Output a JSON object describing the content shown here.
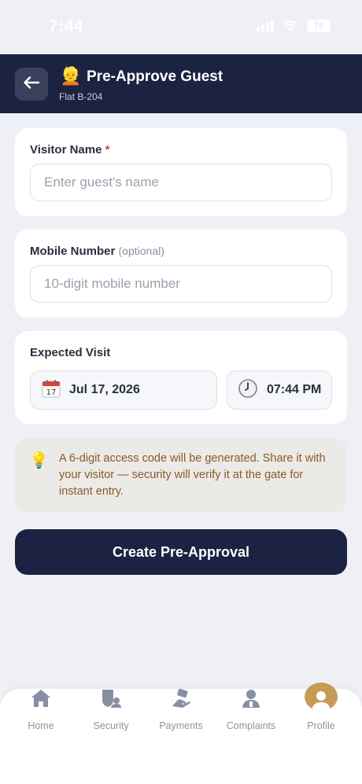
{
  "status_bar": {
    "time": "7:44",
    "battery": "78"
  },
  "header": {
    "emoji": "👱",
    "title": "Pre-Approve Guest",
    "subtitle": "Flat B-204",
    "back_icon": "arrow-left-icon"
  },
  "visitor_name": {
    "label": "Visitor Name",
    "required_mark": "*",
    "placeholder": "Enter guest's name",
    "value": ""
  },
  "mobile_number": {
    "label": "Mobile Number",
    "optional_hint": "(optional)",
    "placeholder": "10-digit mobile number",
    "value": ""
  },
  "expected_visit": {
    "label": "Expected Visit",
    "date": "Jul 17, 2026",
    "date_icon": "📅",
    "date_day": "17",
    "time": "07:44 PM",
    "time_icon": "clock-icon"
  },
  "info": {
    "icon": "💡",
    "text": "A 6-digit access code will be generated. Share it with your visitor — security will verify it at the gate for instant entry."
  },
  "cta": {
    "label": "Create Pre-Approval"
  },
  "bottom_nav": {
    "items": [
      {
        "label": "Home",
        "icon": "home-icon"
      },
      {
        "label": "Security",
        "icon": "security-icon"
      },
      {
        "label": "Payments",
        "icon": "payments-icon"
      },
      {
        "label": "Complaints",
        "icon": "complaints-icon"
      },
      {
        "label": "Profile",
        "icon": "profile-icon"
      }
    ],
    "active": "Profile"
  },
  "colors": {
    "navy": "#1c2241",
    "background": "#eef0f5",
    "info_bg": "#ebeae6",
    "info_text": "#8a5a27",
    "profile_accent": "#c79a55",
    "required": "#d6453a"
  }
}
